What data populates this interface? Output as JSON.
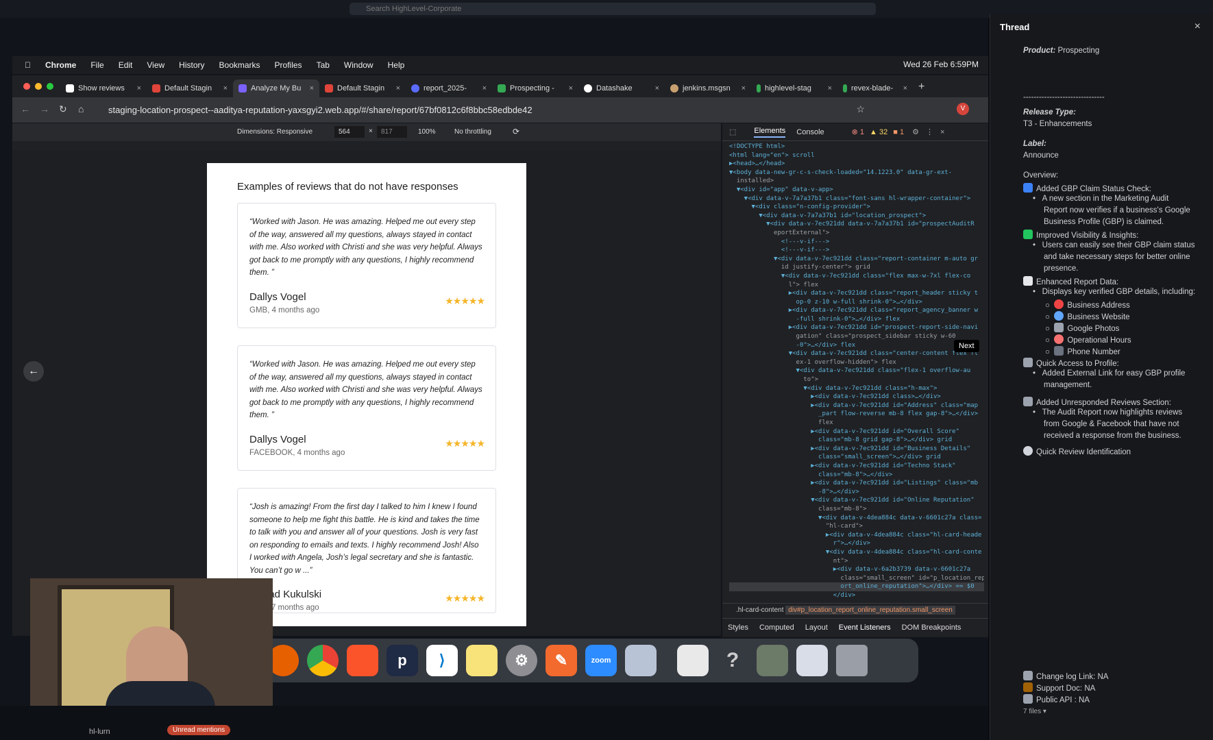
{
  "outer": {
    "search_placeholder": "Search HighLevel-Corporate"
  },
  "menubar": {
    "items": [
      "Chrome",
      "File",
      "Edit",
      "View",
      "History",
      "Bookmarks",
      "Profiles",
      "Tab",
      "Window",
      "Help"
    ],
    "datetime": "Wed 26 Feb 6:59PM"
  },
  "tabs": [
    {
      "label": "Show reviews",
      "color": "#ffffff"
    },
    {
      "label": "Default Stagin",
      "color": "#e0443a"
    },
    {
      "label": "Analyze My Bu",
      "color": "#7b61ff",
      "active": true
    },
    {
      "label": "Default Stagin",
      "color": "#e0443a"
    },
    {
      "label": "report_2025-",
      "color": "#5b6bff"
    },
    {
      "label": "Prospecting -",
      "color": "#34a853"
    },
    {
      "label": "Datashake",
      "color": "#ffffff"
    },
    {
      "label": "jenkins.msgsn",
      "color": "#c8a070"
    },
    {
      "label": "highlevel-stag",
      "color": "#34a853"
    },
    {
      "label": "revex-blade-",
      "color": "#34a853"
    }
  ],
  "address": {
    "url": "staging-location-prospect--aaditya-reputation-yaxsgyi2.web.app/#/share/report/67bf0812c6f8bbc58edbde42"
  },
  "device_toolbar": {
    "dimensions": "Dimensions: Responsive",
    "width": "564",
    "height": "817",
    "zoom": "100%",
    "throttle": "No throttling"
  },
  "report": {
    "heading": "Examples of reviews that do not have responses",
    "reviews": [
      {
        "text": "“Worked with Jason. He was amazing. Helped me out every step of the way, answered all my questions, always stayed in contact with me. Also worked with Christi and she was very helpful. Always got back to me promptly with any questions, I highly recommend them. ”",
        "name": "Dallys Vogel",
        "source": "GMB, 4 months ago",
        "stars": "★★★★★"
      },
      {
        "text": "“Worked with Jason. He was amazing. Helped me out every step of the way, answered all my questions, always stayed in contact with me. Also worked with Christi and she was very helpful. Always got back to me promptly with any questions, I highly recommend them. ”",
        "name": "Dallys Vogel",
        "source": "FACEBOOK, 4 months ago",
        "stars": "★★★★★"
      },
      {
        "text": "“Josh is amazing! From the first day I talked to him I knew I found someone to help me fight this battle. He is kind and takes the time to talk with you and answer all of your questions. Josh is very fast on responding to emails and texts. I highly recommend Josh! Also I worked with Angela, Josh’s legal secretary and she is fantastic. You can’t go w ...”",
        "name": "i Mead Kukulski",
        "source": "OOK, 7 months ago",
        "stars": "★★★★★"
      }
    ]
  },
  "devtools": {
    "tabs": [
      "Elements",
      "Console"
    ],
    "errors": "1",
    "warnings": "32",
    "issues": "1",
    "dom_lines": [
      "<!DOCTYPE html>",
      "<html lang=\"en\"> scroll",
      "▶<head>…</head>",
      "▼<body data-new-gr-c-s-check-loaded=\"14.1223.0\" data-gr-ext-",
      "  installed>",
      "  ▼<div id=\"app\" data-v-app>",
      "    ▼<div data-v-7a7a37b1 class=\"font-sans hl-wrapper-container\">",
      "      ▼<div class=\"n-config-provider\">",
      "        ▼<div data-v-7a7a37b1 id=\"location_prospect\">",
      "          ▼<div data-v-7ec921dd data-v-7a7a37b1 id=\"prospectAuditR",
      "            eportExternal\">",
      "              <!---v-if--->",
      "              <!---v-if--->",
      "            ▼<div data-v-7ec921dd class=\"report-container m-auto gr",
      "              id justify-center\"> grid",
      "              ▼<div data-v-7ec921dd class=\"flex max-w-7xl flex-co",
      "                l\"> flex",
      "                ▶<div data-v-7ec921dd class=\"report_header sticky t",
      "                  op-0 z-10 w-full shrink-0\">…</div>",
      "                ▶<div data-v-7ec921dd class=\"report_agency_banner w",
      "                  -full shrink-0\">…</div> flex",
      "                ▶<div data-v-7ec921dd id=\"prospect-report-side-navi",
      "                  gation\" class=\"prospect_sidebar sticky w-60",
      "                  -0\">…</div> flex",
      "                ▼<div data-v-7ec921dd class=\"center-content flex fl",
      "                  ex-1 overflow-hidden\"> flex",
      "                  ▼<div data-v-7ec921dd class=\"flex-1 overflow-au",
      "                    to\">",
      "                    ▼<div data-v-7ec921dd class=\"h-max\">",
      "                      ▶<div data-v-7ec921dd class>…</div>",
      "                      ▶<div data-v-7ec921dd id=\"Address\" class=\"map",
      "                        _part flow-reverse mb-8 flex gap-8\">…</div>",
      "                        flex",
      "                      ▶<div data-v-7ec921dd id=\"Overall Score\"",
      "                        class=\"mb-8 grid gap-8\">…</div> grid",
      "                      ▶<div data-v-7ec921dd id=\"Business Details\"",
      "                        class=\"small_screen\">…</div> grid",
      "                      ▶<div data-v-7ec921dd id=\"Techno Stack\"",
      "                        class=\"mb-8\">…</div>",
      "                      ▶<div data-v-7ec921dd id=\"Listings\" class=\"mb",
      "                        -8\">…</div>",
      "                      ▼<div data-v-7ec921dd id=\"Online Reputation\"",
      "                        class=\"mb-8\">",
      "                        ▼<div data-v-4dea884c data-v-6601c27a class=",
      "                          \"hl-card\">",
      "                          ▶<div data-v-4dea884c class=\"hl-card-heade",
      "                            r\">…</div>",
      "                          ▼<div data-v-4dea884c class=\"hl-card-conte",
      "                            nt\">",
      "                            ▶<div data-v-6a2b3739 data-v-6601c27a",
      "                              class=\"small_screen\" id=\"p_location_rep",
      "                              ort_online_reputation\">…</div> == $0",
      "                            </div>"
    ],
    "breadcrumb_left": ".hl-card-content",
    "breadcrumb_selected": "div#p_location_report_online_reputation.small_screen",
    "styles_tabs": [
      "Styles",
      "Computed",
      "Layout",
      "Event Listeners",
      "DOM Breakpoints"
    ]
  },
  "tooltip": "Next",
  "thread": {
    "title": "Thread",
    "product_label": "Product:",
    "product_value": "Prospecting",
    "separator": "-------------------------------",
    "release_label": "Release Type:",
    "release_value": "T3 - Enhancements",
    "label_label": "Label:",
    "label_value": "Announce",
    "overview": "Overview:",
    "s1_title": "Added GBP Claim Status Check:",
    "s1_b1": "A new section in the Marketing Audit",
    "s1_b2": "Report now verifies if a business's Google",
    "s1_b3": "Business Profile (GBP) is claimed.",
    "s2_title": "Improved Visibility & Insights:",
    "s2_b1": "Users can easily see their GBP claim status",
    "s2_b2": "and take necessary steps for better online",
    "s2_b3": "presence.",
    "s3_title": "Enhanced Report Data:",
    "s3_b1": "Displays key verified GBP details, including:",
    "s3_items": [
      "Business Address",
      "Business Website",
      "Google Photos",
      "Operational Hours",
      "Phone Number"
    ],
    "s4_title": "Quick Access to Profile:",
    "s4_b1": "Added External Link for easy GBP profile",
    "s4_b2": "management.",
    "s5_title": "Added Unresponded Reviews Section:",
    "s5_b1": "The Audit Report now highlights reviews",
    "s5_b2": "from Google & Facebook that have not",
    "s5_b3": "received a response from the business.",
    "s6_title": "Quick Review Identification",
    "changelog": "Change log Link: NA",
    "supportdoc": "Support Doc: NA",
    "publicapi": "Public API : NA",
    "files": "7 files"
  },
  "bottom": {
    "channel": "hl-lurn",
    "mentions": "Unread mentions"
  },
  "dock": [
    "firefox",
    "chrome",
    "brave",
    "p",
    "vscode",
    "notes",
    "settings",
    "pen",
    "zoom",
    "preview",
    "finder",
    "help",
    "photos",
    "window",
    "trash"
  ]
}
